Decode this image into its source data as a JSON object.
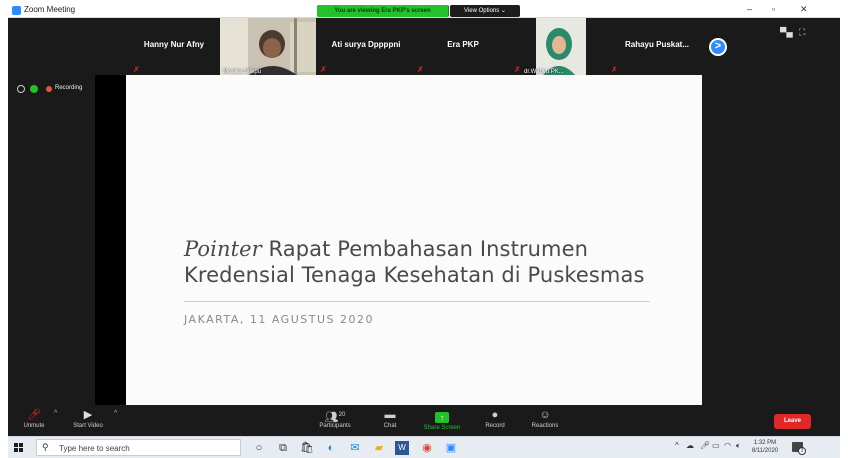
{
  "window": {
    "title": "Zoom Meeting",
    "viewing_banner": "You are viewing Era PKP's screen",
    "view_options": "View Options",
    "minimize": "–",
    "maximize": "▫",
    "close": "✕"
  },
  "participants": [
    {
      "name": "Hanny Nur Afny",
      "video": false,
      "muted": true
    },
    {
      "name": "Monika Sitepu",
      "video": true,
      "muted": true
    },
    {
      "name": "Ati surya Dppppni",
      "video": false,
      "muted": true
    },
    {
      "name": "Era PKP",
      "video": false,
      "muted": true
    },
    {
      "name": "dr.Wahyu PK...",
      "video": true,
      "muted": true
    },
    {
      "name": "Rahayu Puskat...",
      "video": false,
      "muted": true
    }
  ],
  "next_page_label": ">",
  "recording_label": "Recording",
  "slide": {
    "title_italic": "Pointer",
    "title_line1_rest": " Rapat Pembahasan Instrumen",
    "title_line2": "Kredensial Tenaga Kesehatan di Puskesmas",
    "subtitle": "JAKARTA, 11 AGUSTUS 2020"
  },
  "toolbar": {
    "unmute": "Unmute",
    "start_video": "Start Video",
    "participants": "Participants",
    "participants_count": "20",
    "chat": "Chat",
    "share_screen": "Share Screen",
    "record": "Record",
    "reactions": "Reactions",
    "leave": "Leave"
  },
  "taskbar": {
    "search_placeholder": "Type here to search",
    "time": "1:32 PM",
    "date": "8/11/2020",
    "notifications_count": "3"
  },
  "colors": {
    "zoom_blue": "#2d8cff",
    "banner_green": "#23c12a",
    "leave_red": "#e02828",
    "mic_off_red": "#e02828"
  }
}
